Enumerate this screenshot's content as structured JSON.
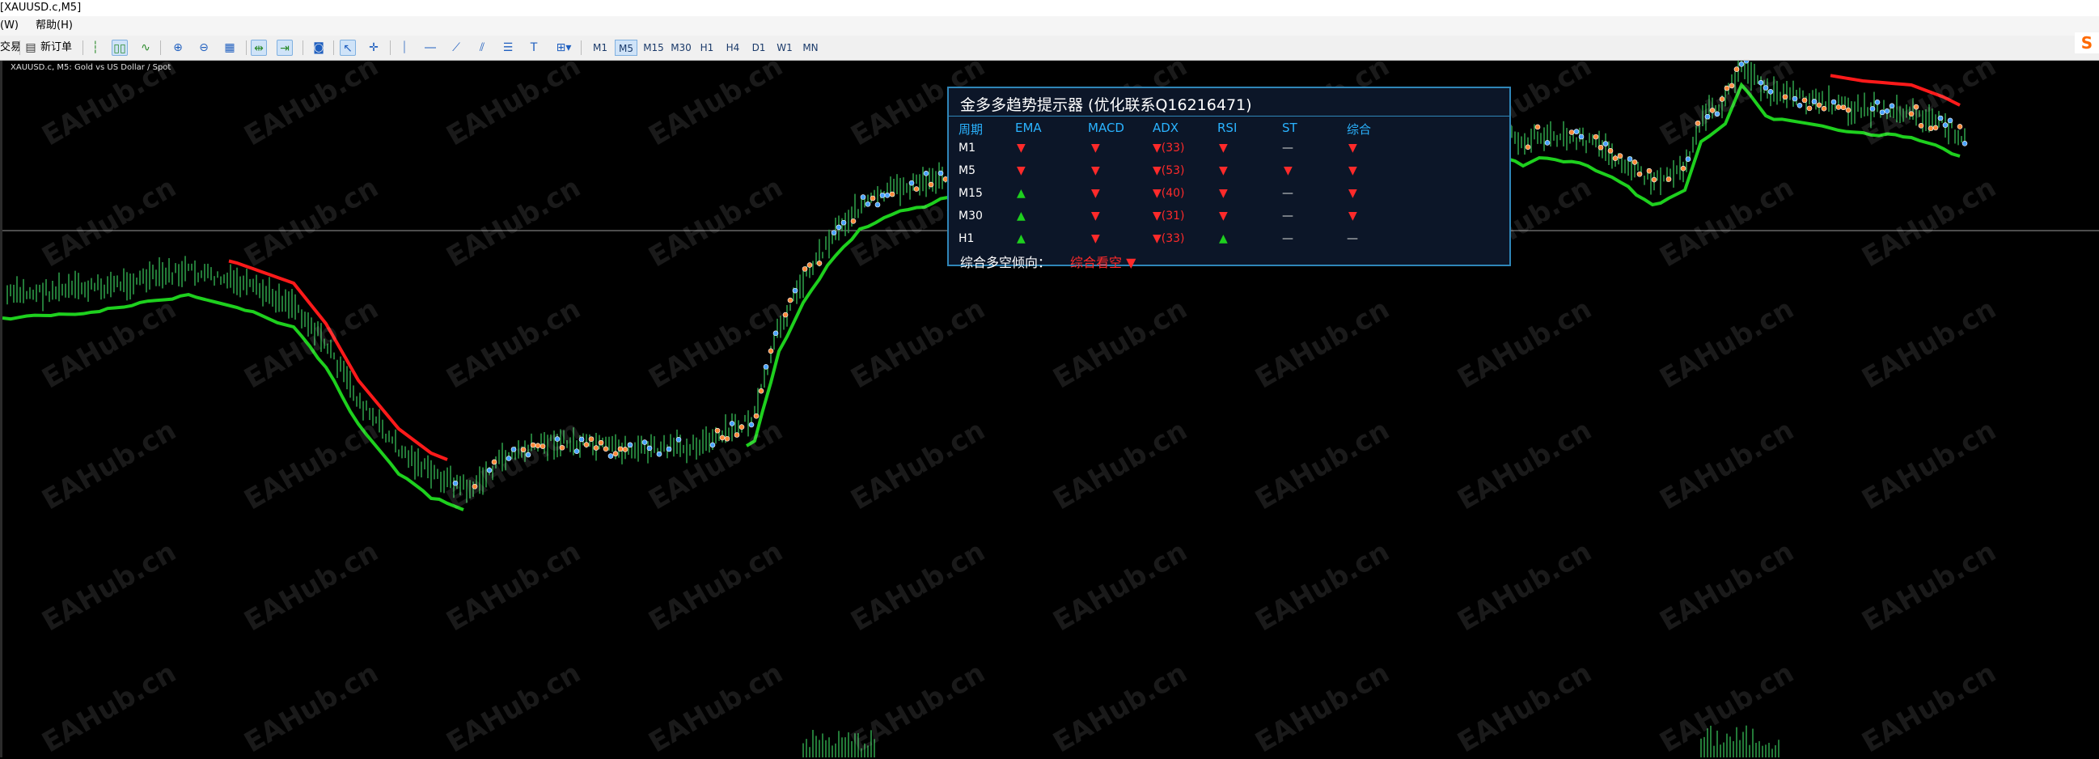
{
  "window": {
    "title": "[XAUUSD.c,M5]"
  },
  "menu": {
    "left_item": "窗口(W)",
    "help": "帮助(H)",
    "left_item_short": "(W)"
  },
  "toolbar": {
    "trade_label": "交易",
    "new_order": "新订单",
    "timeframes": [
      "M1",
      "M5",
      "M15",
      "M30",
      "H1",
      "H4",
      "D1",
      "W1",
      "MN"
    ],
    "active_timeframe": "M5"
  },
  "chart": {
    "symbol_label": "XAUUSD.c, M5:  Gold vs US Dollar / Spot",
    "watermark": "EAHub.cn",
    "colors": {
      "background": "#000000",
      "bull_line": "#1ed01e",
      "bear_line": "#ff1a1a",
      "candle": "#2fa34a",
      "marker_blue": "#4aa3ff",
      "marker_orange": "#ff8a3a"
    }
  },
  "panel": {
    "title": "金多多趋势提示器 (优化联系Q16216471)",
    "headers": [
      "周期",
      "EMA",
      "MACD",
      "ADX",
      "RSI",
      "ST",
      "综合"
    ],
    "rows": [
      {
        "tf": "M1",
        "ema": "▼",
        "macd": "▼",
        "adx": "▼(33)",
        "rsi": "▼",
        "st": "—",
        "sum": "▼",
        "dir": [
          "dn",
          "dn",
          "dn",
          "dn",
          "dash",
          "dn"
        ]
      },
      {
        "tf": "M5",
        "ema": "▼",
        "macd": "▼",
        "adx": "▼(53)",
        "rsi": "▼",
        "st": "▼",
        "sum": "▼",
        "dir": [
          "dn",
          "dn",
          "dn",
          "dn",
          "dn",
          "dn"
        ]
      },
      {
        "tf": "M15",
        "ema": "▲",
        "macd": "▼",
        "adx": "▼(40)",
        "rsi": "▼",
        "st": "—",
        "sum": "▼",
        "dir": [
          "up",
          "dn",
          "dn",
          "dn",
          "dash",
          "dn"
        ]
      },
      {
        "tf": "M30",
        "ema": "▲",
        "macd": "▼",
        "adx": "▼(31)",
        "rsi": "▼",
        "st": "—",
        "sum": "▼",
        "dir": [
          "up",
          "dn",
          "dn",
          "dn",
          "dash",
          "dn"
        ]
      },
      {
        "tf": "H1",
        "ema": "▲",
        "macd": "▼",
        "adx": "▼(33)",
        "rsi": "▲",
        "st": "—",
        "sum": "—",
        "dir": [
          "up",
          "dn",
          "dn",
          "up",
          "dash",
          "dash"
        ]
      }
    ],
    "summary_label": "综合多空倾向：",
    "summary_value": "综合看空 ▼"
  }
}
